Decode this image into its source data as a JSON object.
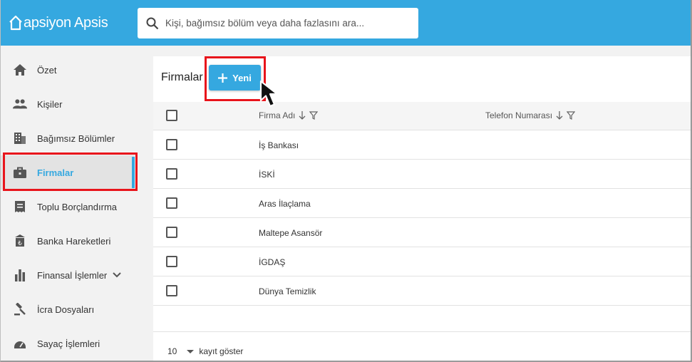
{
  "app": {
    "logo_text": "apsiyon Apsis"
  },
  "search": {
    "placeholder": "Kişi, bağımsız bölüm veya daha fazlasını ara..."
  },
  "sidebar": {
    "items": [
      {
        "label": "Özet",
        "icon": "home-icon"
      },
      {
        "label": "Kişiler",
        "icon": "people-icon"
      },
      {
        "label": "Bağımsız Bölümler",
        "icon": "building-icon"
      },
      {
        "label": "Firmalar",
        "icon": "briefcase-icon",
        "active": true
      },
      {
        "label": "Toplu Borçlandırma",
        "icon": "receipt-icon"
      },
      {
        "label": "Banka Hareketleri",
        "icon": "bank-icon"
      },
      {
        "label": "Finansal İşlemler",
        "icon": "bar-chart-icon",
        "expandable": true
      },
      {
        "label": "İcra Dosyaları",
        "icon": "gavel-icon"
      },
      {
        "label": "Sayaç İşlemleri",
        "icon": "meter-icon"
      }
    ]
  },
  "main": {
    "title": "Firmalar",
    "new_button": "Yeni",
    "columns": [
      "Firma Adı",
      "Telefon Numarası"
    ],
    "rows": [
      {
        "name": "İş Bankası",
        "phone": ""
      },
      {
        "name": "İSKİ",
        "phone": ""
      },
      {
        "name": "Aras İlaçlama",
        "phone": ""
      },
      {
        "name": "Maltepe Asansör",
        "phone": ""
      },
      {
        "name": "İGDAŞ",
        "phone": ""
      },
      {
        "name": "Dünya Temizlik",
        "phone": ""
      }
    ],
    "page_size": "10",
    "page_size_label": "kayıt göster"
  },
  "colors": {
    "brand": "#35a8e0",
    "highlight": "#e8141b"
  }
}
